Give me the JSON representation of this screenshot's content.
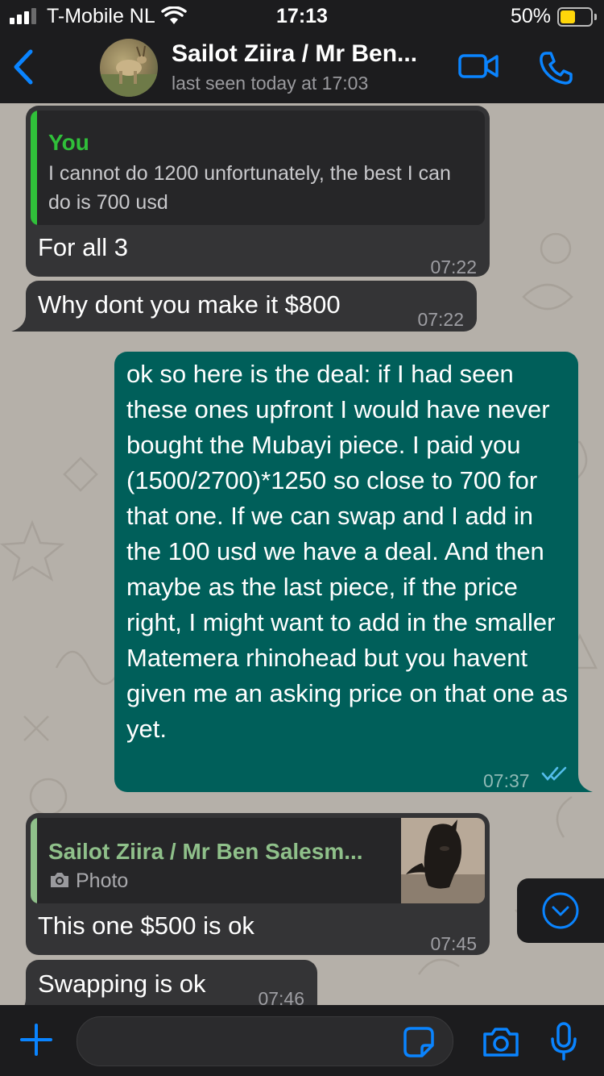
{
  "status_bar": {
    "carrier": "T-Mobile NL",
    "time": "17:13",
    "battery": "50%",
    "battery_level": 0.5,
    "signal_icon": "signal-bars-icon",
    "wifi_icon": "wifi-icon"
  },
  "header": {
    "contact_name": "Sailot Ziira / Mr Ben...",
    "last_seen": "last seen today at 17:03",
    "back_icon": "chevron-left-icon",
    "video_icon": "video-camera-icon",
    "call_icon": "phone-icon"
  },
  "colors": {
    "accent": "#0a84ff",
    "outgoing_bubble": "#005f5a",
    "incoming_bubble": "#343436",
    "quote_you": "#30c03a",
    "quote_contact": "#8fc08a",
    "read_ticks": "#53bdeb"
  },
  "messages": {
    "m1": {
      "quote_author": "You",
      "quote_text": "I cannot do 1200 unfortunately, the best I can do is 700 usd",
      "text": "For all 3",
      "time": "07:22"
    },
    "m2": {
      "text": "Why dont you make it $800",
      "time": "07:22"
    },
    "m3": {
      "text": "ok so here is the deal: if I had seen these ones upfront I would have never bought the Mubayi piece. I paid you (1500/2700)*1250 so close to 700 for that one. If we can swap and I add in the 100 usd we have a deal. And then maybe as the last piece, if the price right, I might want to add in the smaller Matemera rhinohead but you havent given me an asking price on that one as yet.",
      "time": "07:37",
      "status_icon": "double-check-icon"
    },
    "m4": {
      "quote_author": "Sailot Ziira / Mr Ben Salesm...",
      "quote_text": "Photo",
      "quote_icon": "camera-icon",
      "text": "This one $500 is ok",
      "time": "07:45"
    },
    "m5": {
      "text": "Swapping is ok",
      "time": "07:46"
    }
  },
  "input_bar": {
    "plus_icon": "plus-icon",
    "sticker_icon": "sticker-icon",
    "camera_icon": "camera-icon",
    "mic_icon": "microphone-icon",
    "placeholder": ""
  },
  "scroll_down_icon": "chevron-down-circle-icon"
}
